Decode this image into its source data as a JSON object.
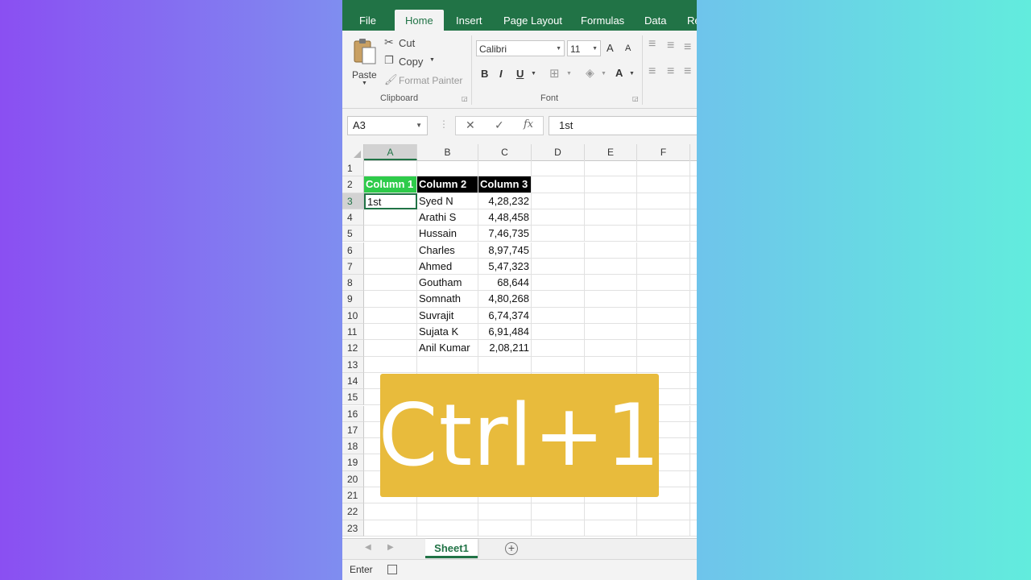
{
  "ribbon_tabs": [
    "File",
    "Home",
    "Insert",
    "Page Layout",
    "Formulas",
    "Data",
    "Re"
  ],
  "active_tab": "Home",
  "clipboard": {
    "paste_label": "Paste",
    "cut_label": "Cut",
    "copy_label": "Copy",
    "format_painter_label": "Format Painter",
    "group_label": "Clipboard"
  },
  "font": {
    "font_name": "Calibri",
    "font_size": "11",
    "grow_label": "A",
    "shrink_label": "A",
    "bold_label": "B",
    "italic_label": "I",
    "underline_label": "U",
    "font_color_label": "A",
    "group_label": "Font"
  },
  "formula_bar": {
    "name_box": "A3",
    "cancel_icon": "x-icon",
    "enter_icon": "check-icon",
    "fx_label": "fx",
    "value": "1st"
  },
  "columns": [
    "A",
    "B",
    "C",
    "D",
    "E",
    "F"
  ],
  "selected_column": "A",
  "rows": [
    "1",
    "2",
    "3",
    "4",
    "5",
    "6",
    "7",
    "8",
    "9",
    "10",
    "11",
    "12",
    "13",
    "14",
    "15",
    "16",
    "17",
    "18",
    "19",
    "20",
    "21",
    "22",
    "23"
  ],
  "selected_row": "3",
  "table": {
    "headers": [
      "Column 1",
      "Column 2",
      "Column 3"
    ],
    "active_cell_value": "1st",
    "names": [
      "Syed N",
      "Arathi S",
      "Hussain",
      "Charles",
      "Ahmed",
      "Goutham",
      "Somnath",
      "Suvrajit",
      "Sujata K",
      "Anil Kumar"
    ],
    "values": [
      "4,28,232",
      "4,48,458",
      "7,46,735",
      "8,97,745",
      "5,47,323",
      "68,644",
      "4,80,268",
      "6,74,374",
      "6,91,484",
      "2,08,211"
    ]
  },
  "overlay_text": "Ctrl+1",
  "sheet_tab": "Sheet1",
  "add_sheet_label": "+",
  "status": "Enter",
  "colors": {
    "excel_green": "#217346",
    "header_green": "#2ecb4a",
    "overlay_gold": "#e8bb3c"
  }
}
